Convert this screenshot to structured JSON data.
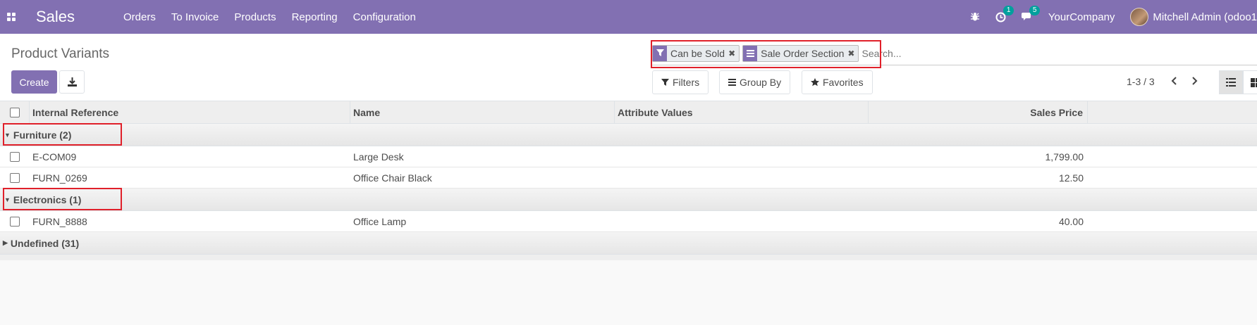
{
  "navbar": {
    "brand": "Sales",
    "menu": [
      "Orders",
      "To Invoice",
      "Products",
      "Reporting",
      "Configuration"
    ],
    "activity_count": "1",
    "messages_count": "5",
    "company": "YourCompany",
    "user": "Mitchell Admin (odoo1"
  },
  "control_panel": {
    "title": "Product Variants",
    "create_label": "Create",
    "facets": [
      {
        "label": "Can be Sold",
        "icon": "filter-icon"
      },
      {
        "label": "Sale Order Section",
        "icon": "group-by-icon"
      }
    ],
    "search_placeholder": "Search...",
    "filters_label": "Filters",
    "groupby_label": "Group By",
    "favorites_label": "Favorites",
    "pager": "1-3 / 3"
  },
  "table": {
    "headers": {
      "ref": "Internal Reference",
      "name": "Name",
      "attr": "Attribute Values",
      "price": "Sales Price"
    },
    "groups": [
      {
        "label": "Furniture (2)",
        "expanded": true,
        "rows": [
          {
            "ref": "E-COM09",
            "name": "Large Desk",
            "attr": "",
            "price": "1,799.00"
          },
          {
            "ref": "FURN_0269",
            "name": "Office Chair Black",
            "attr": "",
            "price": "12.50"
          }
        ]
      },
      {
        "label": "Electronics (1)",
        "expanded": true,
        "rows": [
          {
            "ref": "FURN_8888",
            "name": "Office Lamp",
            "attr": "",
            "price": "40.00"
          }
        ]
      },
      {
        "label": "Undefined (31)",
        "expanded": false,
        "rows": []
      }
    ]
  },
  "colors": {
    "brand": "#8270b2",
    "badge": "#00a09d",
    "highlight": "#e0202a"
  }
}
